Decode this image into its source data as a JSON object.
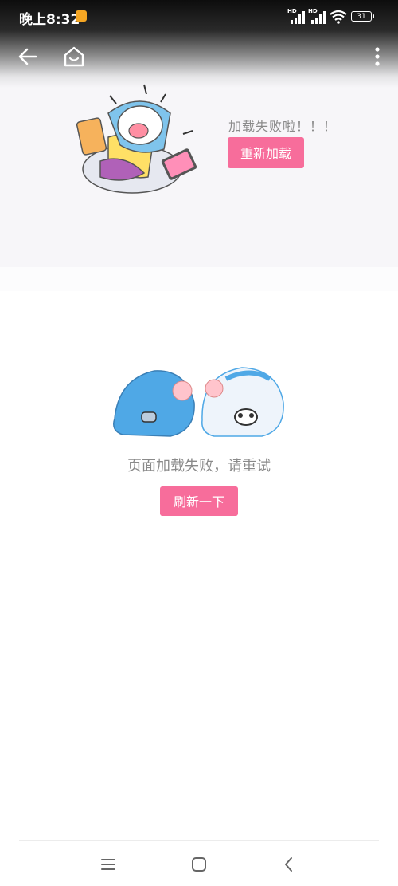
{
  "status_bar": {
    "time": "晚上8:32",
    "signal_1_label": "HD",
    "signal_2_label": "HD",
    "battery": "31"
  },
  "header": {
    "back_icon": "back-arrow-icon",
    "home_icon": "home-icon",
    "more_icon": "more-vertical-icon"
  },
  "upper_error": {
    "message": "加载失败啦！！！",
    "button_label": "重新加载"
  },
  "page_error": {
    "message": "页面加载失败，请重试",
    "button_label": "刷新一下"
  },
  "nav_bar": {
    "icons": [
      "menu-icon",
      "home-square-icon",
      "back-chevron-icon"
    ]
  },
  "colors": {
    "accent": "#f76d9b",
    "muted_text": "#8a8a8a",
    "panel_bg": "#f7f6f9"
  }
}
